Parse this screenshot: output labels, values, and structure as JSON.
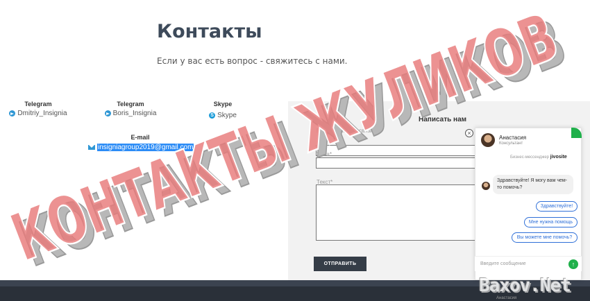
{
  "page": {
    "title": "Контакты",
    "subtitle": "Если у вас есть вопрос - свяжитесь с нами."
  },
  "contacts": [
    {
      "heading": "Telegram",
      "value": "Dmitriy_Insignia",
      "icon": "telegram-icon"
    },
    {
      "heading": "Telegram",
      "value": "Boris_Insignia",
      "icon": "telegram-icon"
    },
    {
      "heading": "Skype",
      "value": "Skype",
      "icon": "skype-icon"
    }
  ],
  "email": {
    "heading": "E-mail",
    "value": "insigniagroup2019@gmail.com",
    "icon": "mail-icon"
  },
  "form": {
    "title": "Написать нам",
    "email_label": "Ваш e-mail (для связи)",
    "subject_label": "Тема*",
    "text_label": "Текст*",
    "submit_label": "ОТПРАВИТЬ"
  },
  "chat": {
    "close_glyph": "×",
    "agent_name": "Анастасия",
    "agent_role": "Консультант",
    "brand_prefix": "Бизнес-мессенджер",
    "brand_name": "jivosite",
    "message_author": "Анастасия",
    "message_text": "Здравствуйте! Я могу вам чем-то помочь?",
    "quick_replies": [
      "Здравствуйте!",
      "Мне нужна помощь",
      "Вы можете мне помочь?"
    ],
    "input_placeholder": "Введите сообщение",
    "send_glyph": "↑",
    "accent_color": "#1fb04a"
  },
  "watermark": {
    "text": "КОНТАКТЫ ЖУЛИКОВ",
    "site": "Baxov.Net",
    "color": "#e87a7a"
  }
}
